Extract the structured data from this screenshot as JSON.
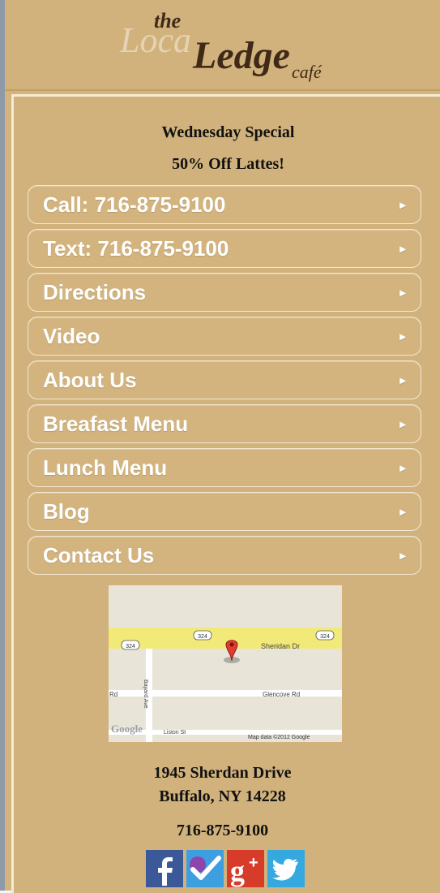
{
  "logo": {
    "the": "the",
    "loca": "Loca",
    "ledge": "Ledge",
    "cafe": "café"
  },
  "special": {
    "line1": "Wednesday Special",
    "line2": "50% Off Lattes!"
  },
  "nav": [
    {
      "label": "Call: 716-875-9100"
    },
    {
      "label": "Text: 716-875-9100"
    },
    {
      "label": "Directions"
    },
    {
      "label": "Video"
    },
    {
      "label": "About Us"
    },
    {
      "label": "Breafast Menu"
    },
    {
      "label": "Lunch Menu"
    },
    {
      "label": "Blog"
    },
    {
      "label": "Contact Us"
    }
  ],
  "chevron": "▸",
  "map": {
    "road_main": "Sheridan Dr",
    "road_cross": "Glencove Rd",
    "road_left": "Rd",
    "road_vertical": "Bayard Ave",
    "road_bottom": "Liston St",
    "route1": "324",
    "route2": "324",
    "route3": "324",
    "google": "Google",
    "copyright": "Map data ©2012 Google"
  },
  "address": {
    "street": "1945 Sherdan Drive",
    "city": "Buffalo, NY 14228",
    "phone": "716-875-9100"
  },
  "social": {
    "facebook_color": "#3b5998",
    "foursquare_color": "#3e9fe0",
    "googleplus_color": "#d73b2a",
    "twitter_color": "#35a8e0"
  }
}
